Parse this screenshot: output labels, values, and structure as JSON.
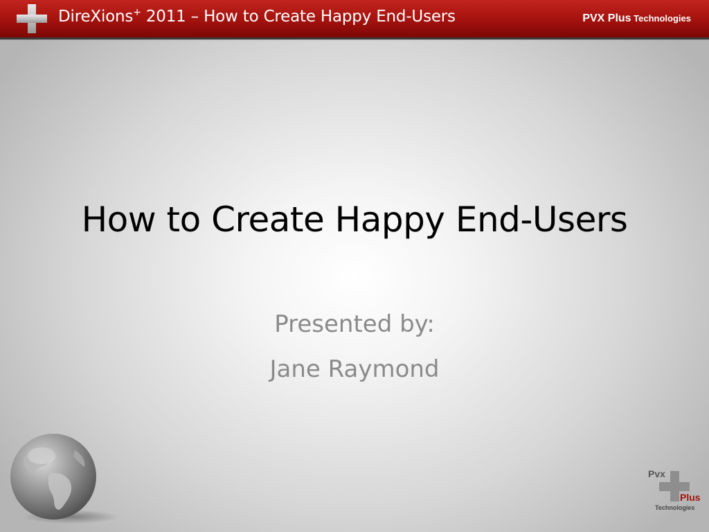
{
  "header": {
    "title_main": "DireXions",
    "title_sup": "+",
    "title_rest": " 2011 – How to Create Happy End-Users",
    "brand_big": "PVX Plus",
    "brand_small": " Technologies",
    "plus_icon": "plus-icon"
  },
  "slide": {
    "title": "How to Create Happy End-Users",
    "subtitle_line1": "Presented by:",
    "subtitle_line2": "Jane Raymond"
  },
  "footer": {
    "globe_icon": "globe-icon",
    "logo": {
      "pvx": "Pvx",
      "plus": "Plus",
      "technologies": "Technologies"
    }
  },
  "colors": {
    "header_red": "#a3120e",
    "subtitle_gray": "#8a8a8a",
    "title_black": "#000000"
  }
}
